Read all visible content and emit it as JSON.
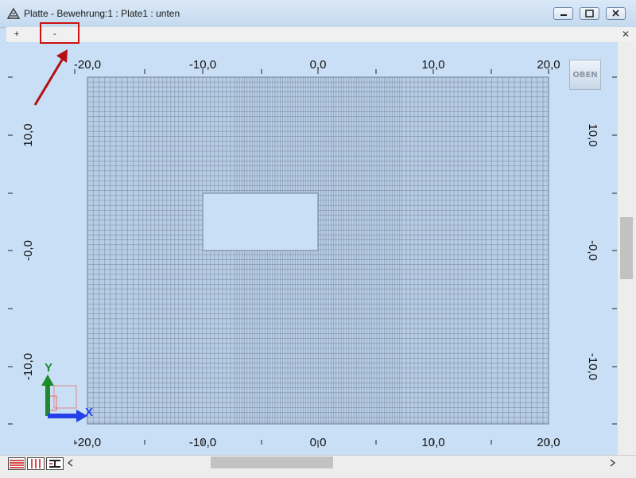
{
  "window": {
    "title": "Platte - Bewehrung:1 : Plate1  : unten",
    "controls": [
      "minimize",
      "maximize",
      "close"
    ]
  },
  "tabs": [
    {
      "label": "+"
    },
    {
      "label": "-"
    }
  ],
  "tab_close": "✕",
  "axes": {
    "top_labels": [
      "-20,0",
      "-10,0",
      "0,0",
      "10,0",
      "20,0"
    ],
    "bottom_labels": [
      "-20,0",
      "-10,0",
      "0,0",
      "10,0",
      "20,0"
    ],
    "left_labels": [
      "10,0",
      "-0,0",
      "-10,0"
    ],
    "right_labels": [
      "10,0",
      "-0,0",
      "-10,0"
    ]
  },
  "view_cube_label": "OBEN",
  "coord_system": {
    "x_label": "X",
    "y_label": "Y"
  },
  "bottom_tools": [
    {
      "icon": "horizontal-lines-icon"
    },
    {
      "icon": "vertical-lines-icon"
    },
    {
      "icon": "section-icon"
    }
  ],
  "colors": {
    "background": "#c9dff5",
    "mesh": "#6f7f95",
    "mesh_fill": "#b7cde5",
    "annotation": "#cc1111",
    "axis_x": "#2341e8",
    "axis_y": "#1d8a2c"
  }
}
